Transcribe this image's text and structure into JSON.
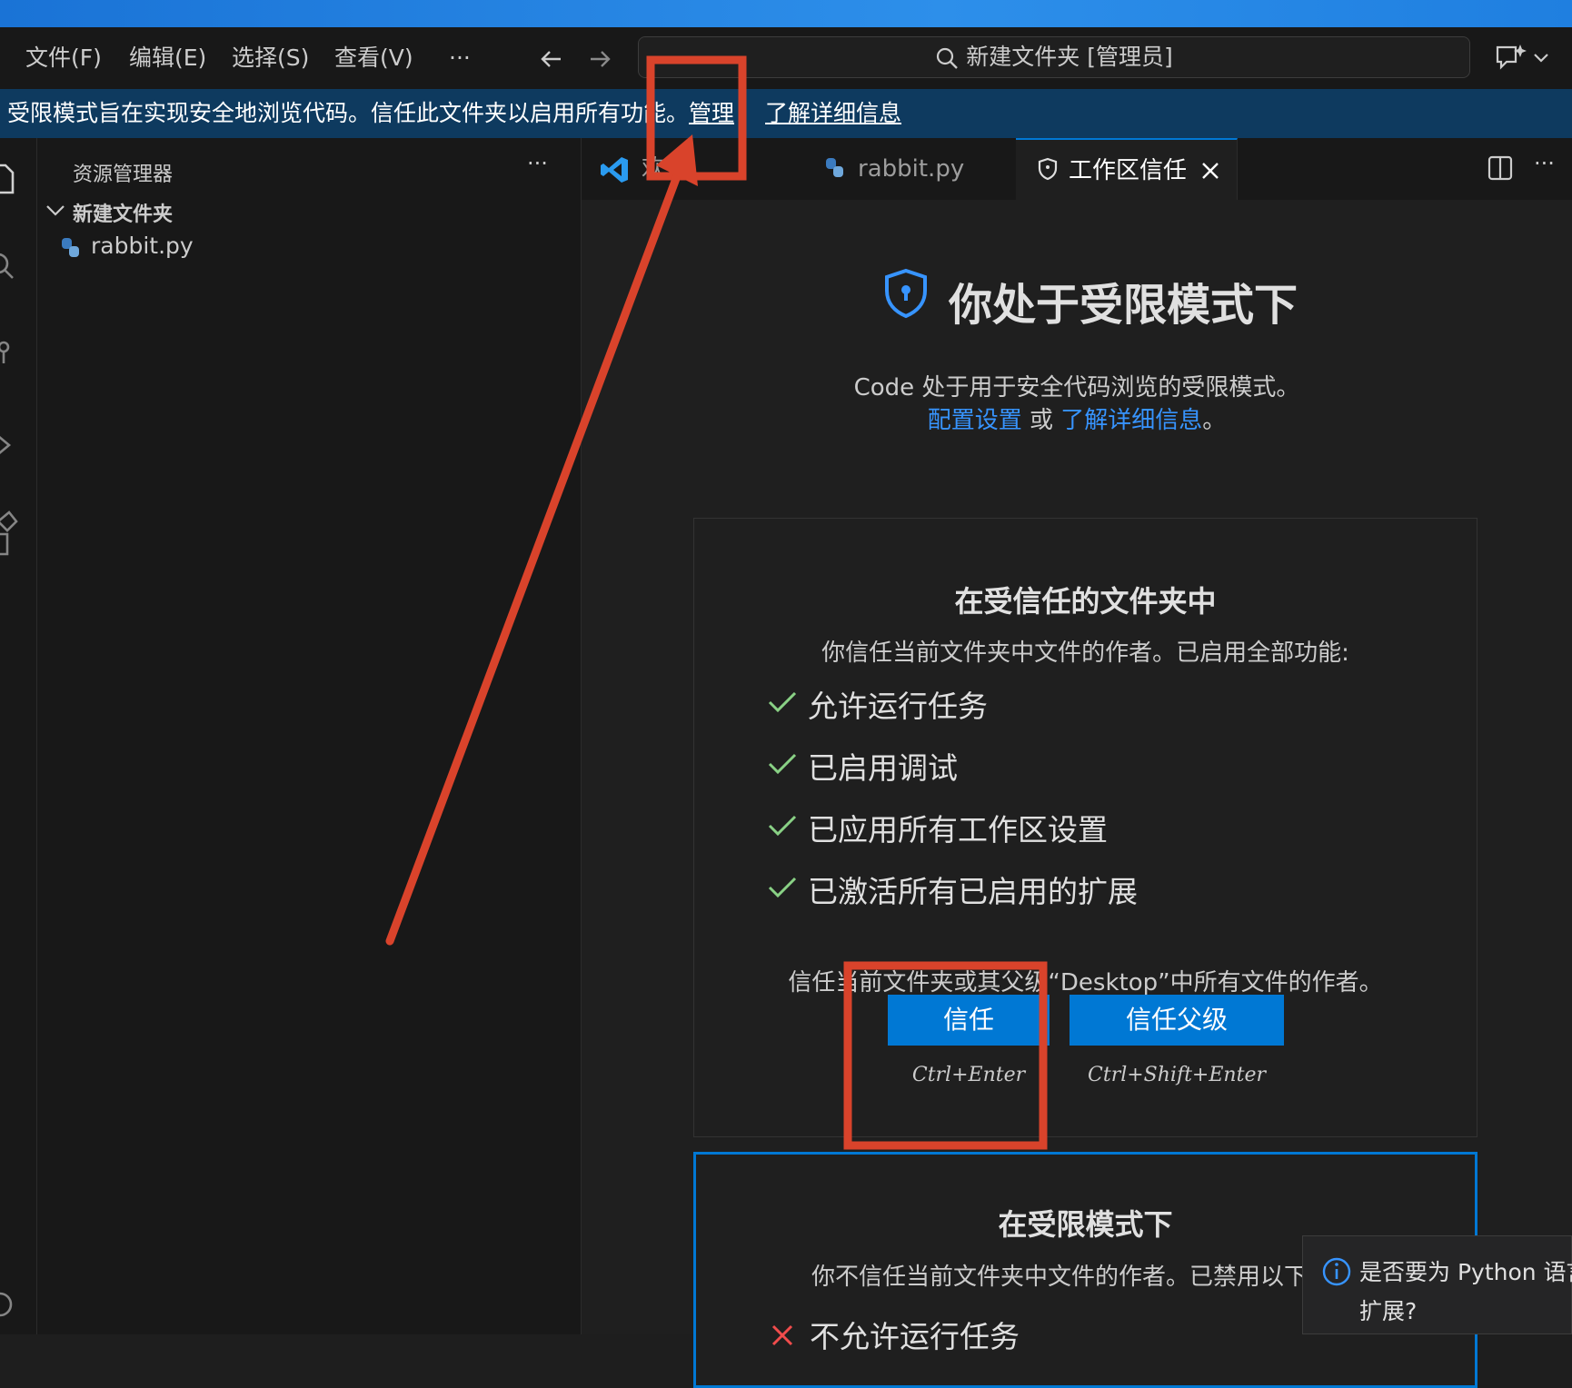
{
  "menu": {
    "file": "文件(F)",
    "edit": "编辑(E)",
    "selection": "选择(S)",
    "view": "查看(V)",
    "more": "···"
  },
  "command_center": {
    "text": "新建文件夹 [管理员]"
  },
  "banner": {
    "message": "受限模式旨在实现安全地浏览代码。信任此文件夹以启用所有功能。",
    "manage": "管理",
    "learn_more": "了解详细信息"
  },
  "sidebar": {
    "title": "资源管理器",
    "more": "···",
    "folder": "新建文件夹",
    "file": "rabbit.py"
  },
  "tabs": [
    {
      "label": "欢迎"
    },
    {
      "label": "rabbit.py"
    },
    {
      "label": "工作区信任"
    }
  ],
  "content": {
    "heading": "你处于受限模式下",
    "desc_line1": "Code 处于用于安全代码浏览的受限模式。",
    "config_link": "配置设置",
    "or": "或",
    "learn_link": "了解详细信息",
    "period": "。",
    "trusted": {
      "title": "在受信任的文件夹中",
      "subtitle": "你信任当前文件夹中文件的作者。已启用全部功能:",
      "features": [
        "允许运行任务",
        "已启用调试",
        "已应用所有工作区设置",
        "已激活所有已启用的扩展"
      ],
      "trust_note": "信任当前文件夹或其父级“Desktop”中所有文件的作者。",
      "trust_button": "信任",
      "trust_kbd": "Ctrl+Enter",
      "trust_parent_button": "信任父级",
      "trust_parent_kbd": "Ctrl+Shift+Enter"
    },
    "restricted": {
      "title": "在受限模式下",
      "subtitle": "你不信任当前文件夹中文件的作者。已禁用以下",
      "features": [
        "不允许运行任务"
      ]
    }
  },
  "notification": {
    "text_line1": "是否要为 Python 语言",
    "text_line2": "扩展?"
  },
  "colors": {
    "accent": "#0078d4",
    "link": "#3794ff",
    "check": "#89d185",
    "cross": "#f14c4c",
    "annotation": "#d9432b"
  }
}
